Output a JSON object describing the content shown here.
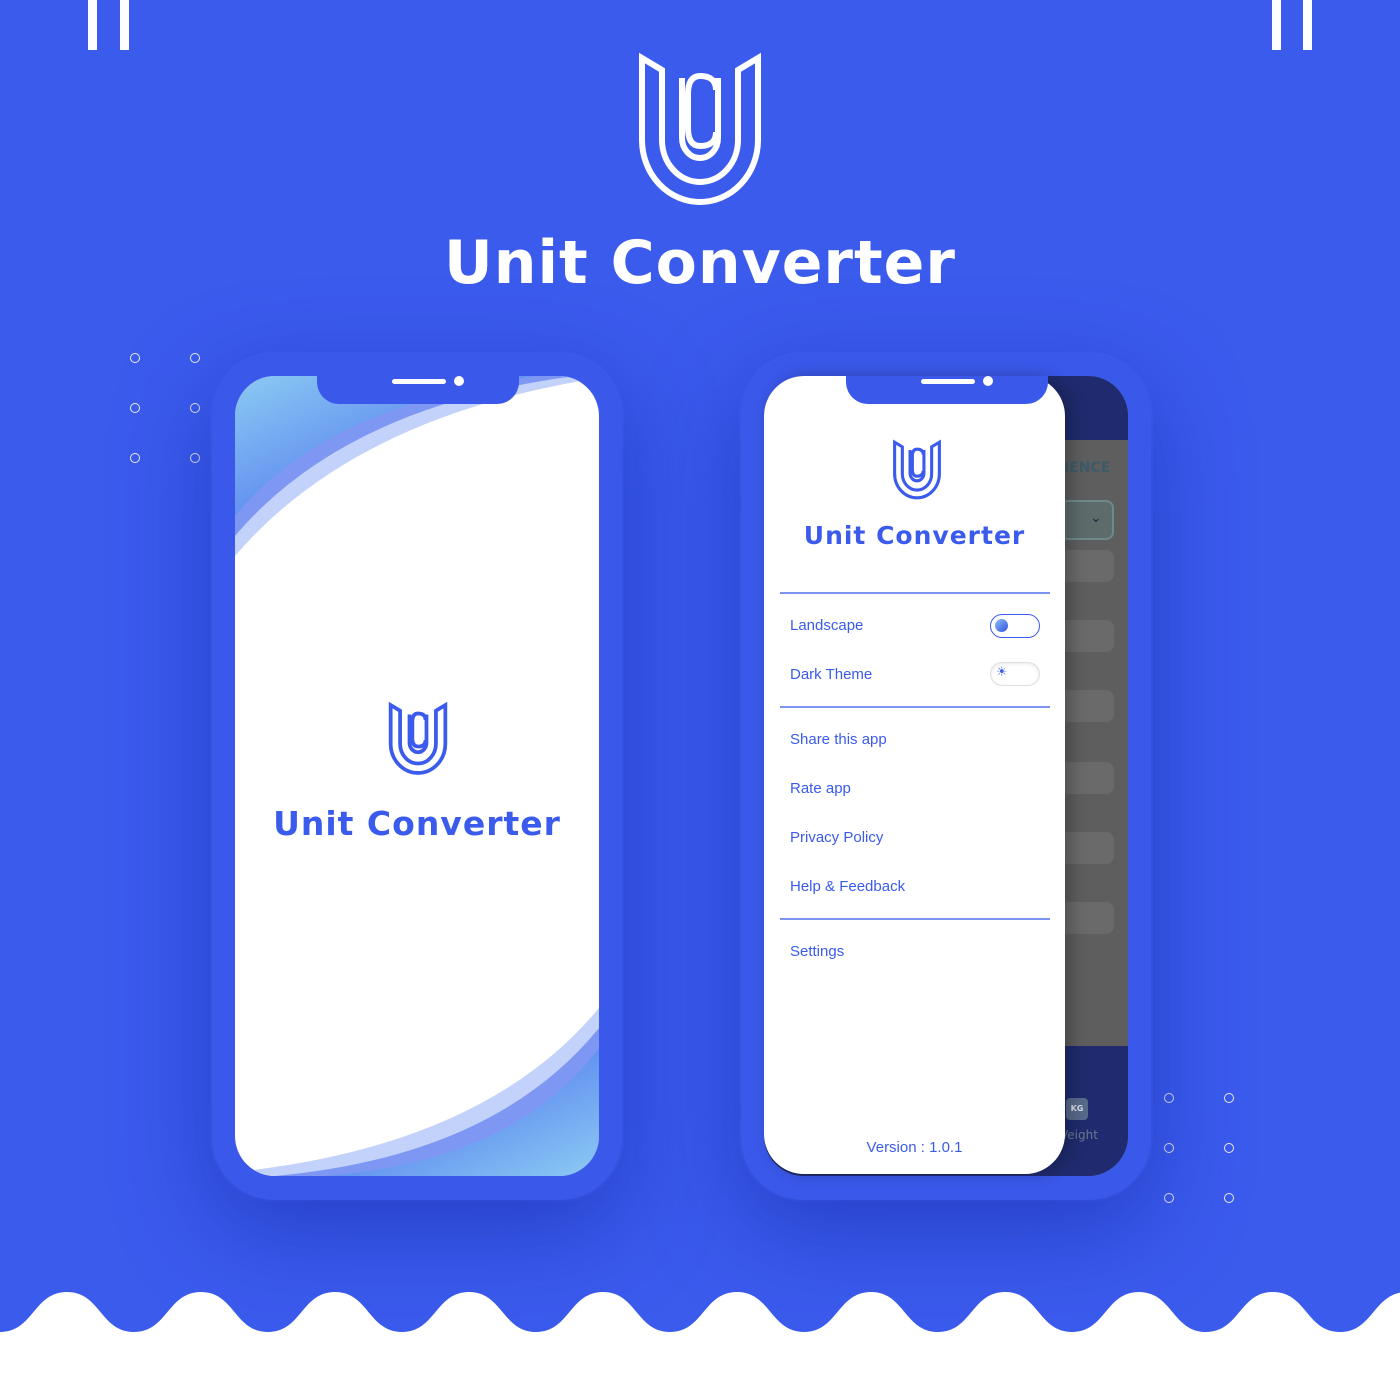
{
  "brand": {
    "title": "Unit Converter",
    "logo_icon": "uc-shield-logo-icon",
    "accent_color": "#3b5bed",
    "background_color": "#3b5bed"
  },
  "splash_screen": {
    "title": "Unit Converter"
  },
  "drawer": {
    "title": "Unit Converter",
    "toggles": [
      {
        "label": "Landscape",
        "state": "on"
      },
      {
        "label": "Dark Theme",
        "state": "off",
        "icon": "sun-icon"
      }
    ],
    "links": [
      {
        "label": "Share this app"
      },
      {
        "label": "Rate app"
      },
      {
        "label": "Privacy Policy"
      },
      {
        "label": "Help & Feedback"
      }
    ],
    "settings_label": "Settings",
    "version": "Version : 1.0.1"
  },
  "background_screen": {
    "header_fragment": "IENCE",
    "tab_label_fragment": "Veight",
    "tab_icon_text": "KG"
  }
}
